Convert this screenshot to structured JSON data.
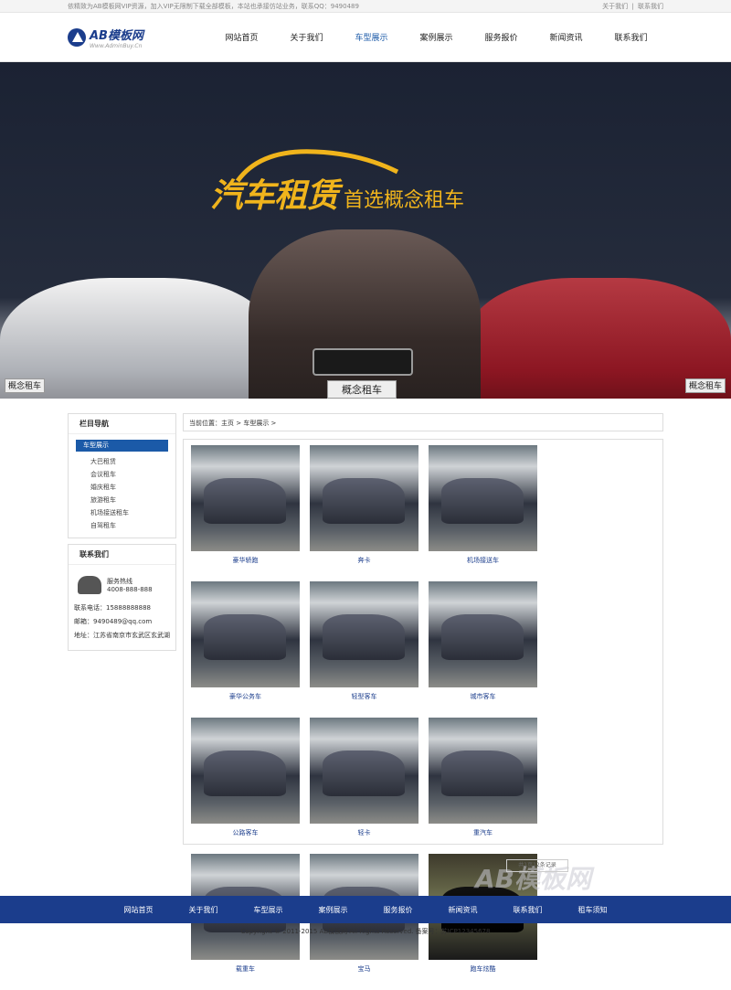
{
  "topbar": {
    "left": "依精致为AB模板网VIP资源，加入VIP无限制下载全部模板，本站也承接仿站业务，联系QQ：9490489",
    "links": [
      "关于我们",
      "|",
      "联系我们"
    ]
  },
  "header": {
    "logo_title": "AB模板网",
    "logo_sub": "Www.AdminBuy.Cn",
    "nav": [
      "网站首页",
      "关于我们",
      "车型展示",
      "案例展示",
      "服务报价",
      "新闻资讯",
      "联系我们"
    ],
    "active_nav": "车型展示"
  },
  "banner": {
    "slogan_main": "汽车租赁",
    "slogan_sub": "首选概念租车",
    "plate": "概念租车"
  },
  "sidebar": {
    "nav_title": "栏目导航",
    "active_category": "车型展示",
    "categories": [
      "大巴租赁",
      "会议租车",
      "婚庆租车",
      "旅游租车",
      "机场接送租车",
      "自驾租车"
    ],
    "contact_title": "联系我们",
    "hotline_label": "服务热线",
    "hotline_number": "4008-888-888",
    "phone": "联系电话：15888888888",
    "email": "邮箱：9490489@qq.com",
    "address": "地址：江苏省南京市玄武区玄武湖"
  },
  "content": {
    "breadcrumb": "当前位置：主页 > 车型展示 >",
    "watermark": "AB模板网",
    "items": [
      "豪华轿跑",
      "奔卡",
      "机场接送车",
      "豪华公务车",
      "轻型客车",
      "城市客车",
      "公路客车",
      "轻卡",
      "重汽车",
      "载重车",
      "宝马",
      "跑车炫酷"
    ],
    "pager": "共1页12条记录"
  },
  "footer": {
    "nav": [
      "网站首页",
      "关于我们",
      "车型展示",
      "案例展示",
      "服务报价",
      "新闻资讯",
      "联系我们",
      "租车须知"
    ],
    "copyright": "Copyright © 2011-2015 AB模板网 All Rights Reserved.    备案号：苏ICP12345678"
  }
}
